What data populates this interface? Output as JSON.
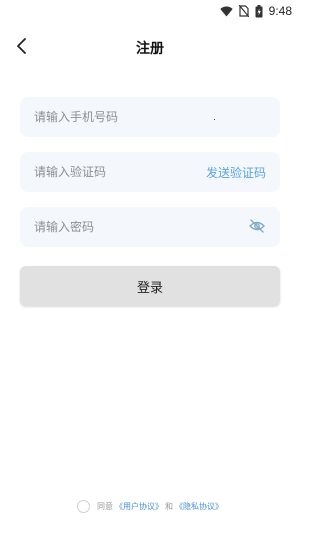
{
  "status_bar": {
    "time": "9:48",
    "icons": [
      "wifi-icon",
      "no-sim-icon",
      "battery-icon"
    ]
  },
  "nav": {
    "title": "注册",
    "back_icon": "chevron-left-icon"
  },
  "form": {
    "phone_placeholder": "请输入手机号码",
    "code_placeholder": "请输入验证码",
    "send_code_label": "发送验证码",
    "password_placeholder": "请输入密码",
    "password_toggle_icon": "eye-off-icon",
    "submit_label": "登录"
  },
  "agreement": {
    "agree_text": "同意",
    "user_agreement": "《用户协议》",
    "and_text": "和",
    "privacy_policy": "《隐私协议》"
  },
  "colors": {
    "field_bg": "#f4f8fc",
    "link": "#5aa3e0",
    "button_bg": "#e1e1e1"
  }
}
